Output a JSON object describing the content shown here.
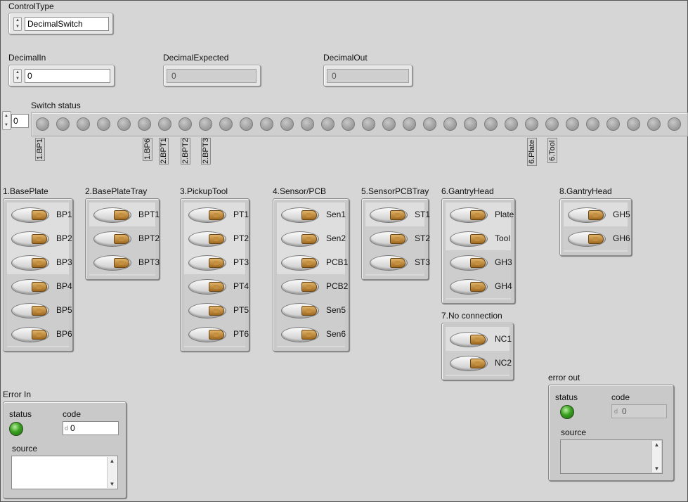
{
  "control_type": {
    "label": "ControlType",
    "value": "DecimalSwitch"
  },
  "decimal_in": {
    "label": "DecimalIn",
    "value": "0"
  },
  "decimal_expected": {
    "label": "DecimalExpected",
    "value": "0"
  },
  "decimal_out": {
    "label": "DecimalOut",
    "value": "0"
  },
  "switch_status": {
    "label": "Switch status",
    "index": "0",
    "led_count": 32,
    "tags": [
      "1.BP1",
      "1.BP6",
      "2.BPT1",
      "2.BPT2",
      "2.BPT3",
      "6.Plate",
      "6.Tool"
    ]
  },
  "clusters": [
    {
      "title": "1.BasePlate",
      "switches": [
        "BP1",
        "BP2",
        "BP3",
        "BP4",
        "BP5",
        "BP6"
      ]
    },
    {
      "title": "2.BasePlateTray",
      "switches": [
        "BPT1",
        "BPT2",
        "BPT3"
      ]
    },
    {
      "title": "3.PickupTool",
      "switches": [
        "PT1",
        "PT2",
        "PT3",
        "PT4",
        "PT5",
        "PT6"
      ]
    },
    {
      "title": "4.Sensor/PCB",
      "switches": [
        "Sen1",
        "Sen2",
        "PCB1",
        "PCB2",
        "Sen5",
        "Sen6"
      ]
    },
    {
      "title": "5.SensorPCBTray",
      "switches": [
        "ST1",
        "ST2",
        "ST3"
      ]
    },
    {
      "title": "6.GantryHead",
      "switches": [
        "Plate",
        "Tool",
        "GH3",
        "GH4"
      ]
    },
    {
      "title": "7.No connection",
      "switches": [
        "NC1",
        "NC2"
      ]
    },
    {
      "title": "8.GantryHead",
      "switches": [
        "GH5",
        "GH6"
      ]
    }
  ],
  "error_in": {
    "title": "Error In",
    "status_label": "status",
    "code_label": "code",
    "code_value": "0",
    "code_prefix": "d",
    "source_label": "source",
    "source_value": ""
  },
  "error_out": {
    "title": "error out",
    "status_label": "status",
    "code_label": "code",
    "code_value": "0",
    "code_prefix": "d",
    "source_label": "source",
    "source_value": ""
  },
  "colors": {
    "panel": "#d6d6d6",
    "led_on": "#3aa020",
    "led_off": "#a3a3a3",
    "switch_knob": "#c49040"
  }
}
